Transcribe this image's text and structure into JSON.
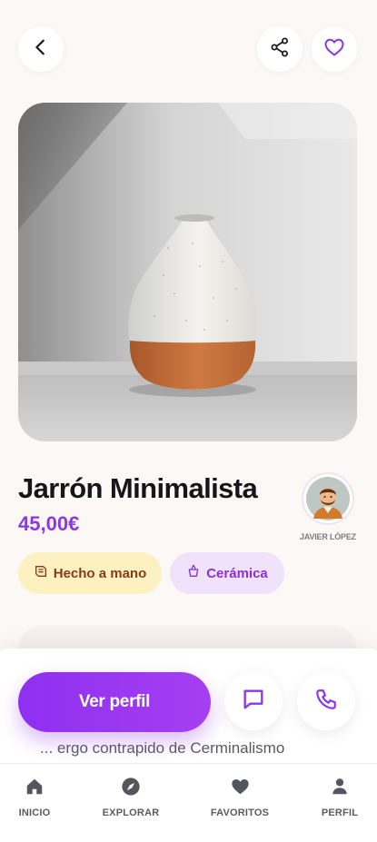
{
  "header": {
    "back_icon": "chevron-left-icon",
    "share_icon": "share-icon",
    "favorite_icon": "heart-outline-icon"
  },
  "product": {
    "title": "Jarrón Minimalista",
    "price": "45,00€",
    "image": "white speckled ceramic vase with terracotta base"
  },
  "seller": {
    "name": "JAVIER LÓPEZ"
  },
  "tags": [
    {
      "label": "Hecho a mano",
      "icon": "handmade-icon"
    },
    {
      "label": "Cerámica",
      "icon": "pottery-icon"
    }
  ],
  "description_peek": "... ergo contrapido de Cerminalismo",
  "actions": {
    "primary_label": "Ver perfil",
    "chat_icon": "chat-icon",
    "call_icon": "phone-icon"
  },
  "nav": {
    "items": [
      {
        "label": "INICIO",
        "icon": "home-icon"
      },
      {
        "label": "EXPLORAR",
        "icon": "compass-icon"
      },
      {
        "label": "FAVORITOS",
        "icon": "heart-icon"
      },
      {
        "label": "PERFIL",
        "icon": "user-icon"
      }
    ]
  },
  "colors": {
    "accent": "#8e35e6",
    "background": "#fbf8f6",
    "handmade_tag_bg": "#fdf1c2",
    "ceramic_tag_bg": "#f0e2fb"
  }
}
